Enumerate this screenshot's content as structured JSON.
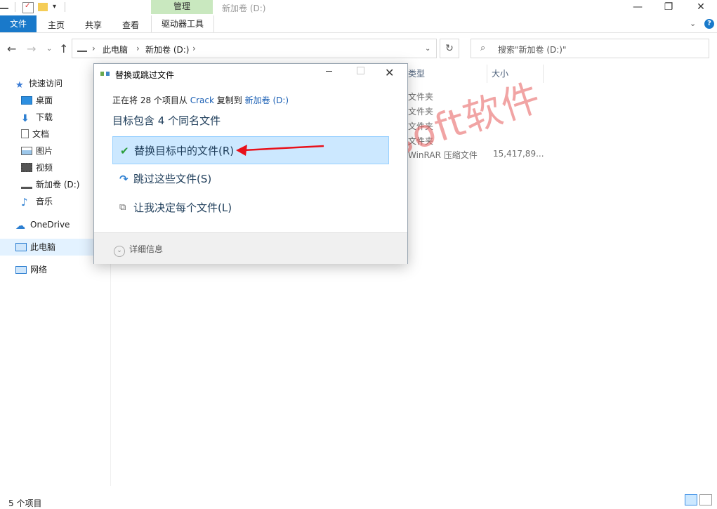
{
  "titlebar": {
    "manage_tab": "管理",
    "window_title": "新加卷 (D:)",
    "minimize": "—",
    "maximize": "❐",
    "close": "✕"
  },
  "ribbon": {
    "file": "文件",
    "home": "主页",
    "share": "共享",
    "view": "查看",
    "drive_tools": "驱动器工具",
    "help": "?"
  },
  "address": {
    "crumbs": [
      "此电脑",
      "新加卷 (D:)"
    ],
    "search_placeholder": "搜索\"新加卷 (D:)\""
  },
  "sidebar": {
    "items": [
      {
        "label": "快速访问",
        "icon": "star-icon"
      },
      {
        "label": "桌面",
        "icon": "desktop-icon"
      },
      {
        "label": "下载",
        "icon": "download-icon"
      },
      {
        "label": "文档",
        "icon": "document-icon"
      },
      {
        "label": "图片",
        "icon": "picture-icon"
      },
      {
        "label": "视频",
        "icon": "video-icon"
      },
      {
        "label": "新加卷 (D:)",
        "icon": "drive-icon"
      },
      {
        "label": "音乐",
        "icon": "music-icon"
      },
      {
        "label": "OneDrive",
        "icon": "cloud-icon"
      },
      {
        "label": "此电脑",
        "icon": "computer-icon"
      },
      {
        "label": "网络",
        "icon": "network-icon"
      }
    ]
  },
  "content": {
    "columns": {
      "type": "类型",
      "size": "大小"
    },
    "rows": [
      {
        "type": "文件夹",
        "size": ""
      },
      {
        "type": "文件夹",
        "size": ""
      },
      {
        "type": "文件夹",
        "size": ""
      },
      {
        "type": "文件夹",
        "size": ""
      },
      {
        "type": "WinRAR 压缩文件",
        "size": "15,417,89..."
      }
    ]
  },
  "status": {
    "count": "5 个项目"
  },
  "dialog": {
    "title": "替换或跳过文件",
    "info_prefix": "正在将 28 个项目从",
    "source": "Crack",
    "info_mid": "复制到",
    "target": "新加卷 (D:)",
    "heading": "目标包含 4 个同名文件",
    "options": [
      {
        "label": "替换目标中的文件(R)",
        "icon": "checkmark-icon"
      },
      {
        "label": "跳过这些文件(S)",
        "icon": "skip-icon"
      },
      {
        "label": "让我决定每个文件(L)",
        "icon": "decide-icon"
      }
    ],
    "details": "详细信息"
  },
  "watermark": "微信公众号：soft软件",
  "colors": {
    "accent": "#1979ca",
    "manage_tab_bg": "#c9e8bf",
    "highlight": "#cce8ff",
    "arrow": "#e8111b"
  }
}
